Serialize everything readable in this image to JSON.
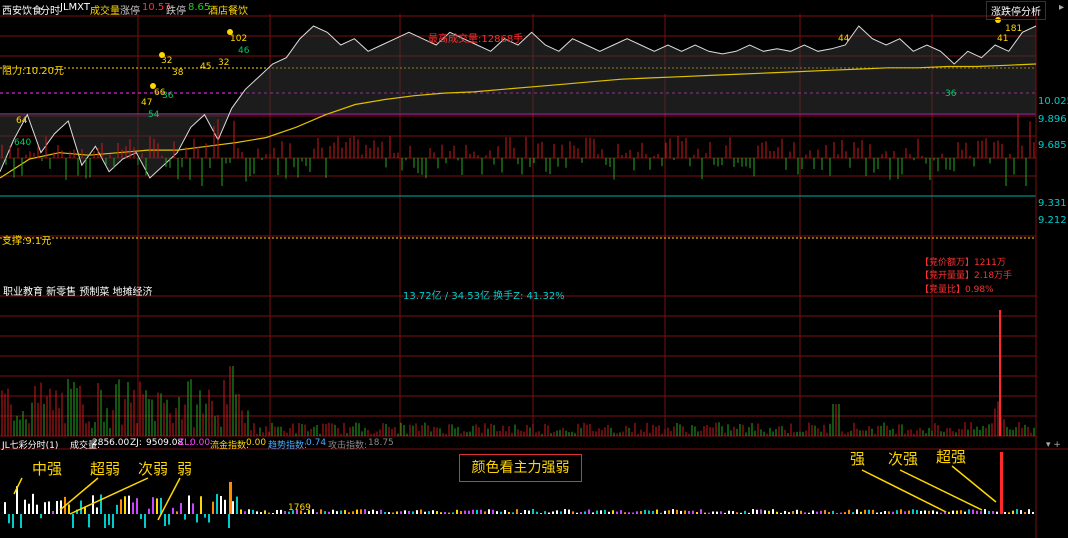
{
  "header": {
    "stock_name": "西安饮食",
    "view_mode": "分时",
    "indicator": "JLMXT",
    "volume_label": "成交量",
    "limit_up_label": "涨停",
    "limit_up_value": "10.57",
    "limit_down_label": "跌停",
    "limit_down_value": "8.65",
    "sector": "酒店餐饮",
    "analysis_button": "涨跌停分析"
  },
  "price_panel": {
    "resistance": "阻力:10.20元",
    "support": "支撑:9.1元",
    "max_volume_note": "最高成交量:12868手",
    "right_axis": [
      "10.025",
      "9.896",
      "9.685",
      "9.331",
      "9.212"
    ],
    "peak_labels": [
      "102",
      "64",
      "32",
      "47",
      "66",
      "36",
      "45",
      "32",
      "38",
      "46",
      "54",
      "640",
      "44",
      "36",
      "181",
      "41"
    ],
    "concepts": "职业教育 新零售 预制菜 地摊经济",
    "turnover": "13.72亿 / 34.53亿 换手Z: 41.32%",
    "auction_amount": "【竞价额万】1211万",
    "auction_volume": "【竞开量量】2.18万手",
    "auction_ratio": "【竞量比】0.98%"
  },
  "indicator_bar": {
    "name": "JL七彩分时(1)",
    "vol_label": "成交量:",
    "vol": "2856.00",
    "zj_label": "ZJ:",
    "zj": "9509.08",
    "zl_label": "ZL:",
    "zl": "0.00",
    "flow_label": "流金指数:",
    "flow": "0.00",
    "trend_label": "趋势指数:",
    "trend": "0.74",
    "attack_label": "攻击指数:",
    "attack": "18.75",
    "bar_value": "1769"
  },
  "annotations": {
    "title": "颜色看主力强弱",
    "zhongqiang": "中强",
    "chaoruo": "超弱",
    "ciruo": "次弱",
    "ruo": "弱",
    "qiang": "强",
    "ciqiang": "次强",
    "chaoqiang": "超强"
  },
  "chart_data": {
    "type": "line",
    "series": [
      {
        "values": [
          9.45,
          9.7,
          9.9,
          9.6,
          9.75,
          9.85,
          9.5,
          9.65,
          9.45,
          9.55,
          9.6,
          9.4,
          9.5,
          9.6,
          9.8,
          9.9,
          9.7,
          9.95,
          10.1,
          10.2,
          10.3,
          10.35,
          10.5,
          10.6,
          10.55,
          10.45,
          10.5,
          10.4,
          10.45,
          10.5,
          10.55,
          10.5,
          10.45,
          10.55,
          10.5,
          10.45,
          10.4,
          10.5,
          10.45,
          10.55,
          10.45,
          10.4,
          10.5,
          10.45,
          10.4,
          10.45,
          10.5,
          10.45,
          10.4,
          10.45,
          10.4,
          10.45,
          10.4,
          10.38,
          10.4,
          10.45,
          10.4,
          10.42,
          10.4,
          10.45,
          10.4,
          10.42,
          10.45,
          10.6,
          10.5,
          10.45,
          10.5,
          10.4,
          10.45,
          10.4,
          10.3,
          10.4,
          10.35,
          10.45,
          10.4,
          10.55,
          10.6
        ]
      },
      {
        "values": [
          9.4,
          9.55,
          9.6,
          9.58,
          9.6,
          9.62,
          9.62,
          9.65,
          9.68,
          9.72,
          9.8,
          9.9,
          9.98,
          10.02,
          10.05,
          10.07,
          10.08,
          10.1,
          10.12,
          10.14,
          10.16,
          10.18,
          10.19,
          10.2,
          10.21,
          10.22,
          10.23,
          10.24,
          10.25,
          10.26,
          10.27,
          10.27,
          10.28,
          10.28,
          10.29,
          10.3
        ]
      }
    ]
  }
}
